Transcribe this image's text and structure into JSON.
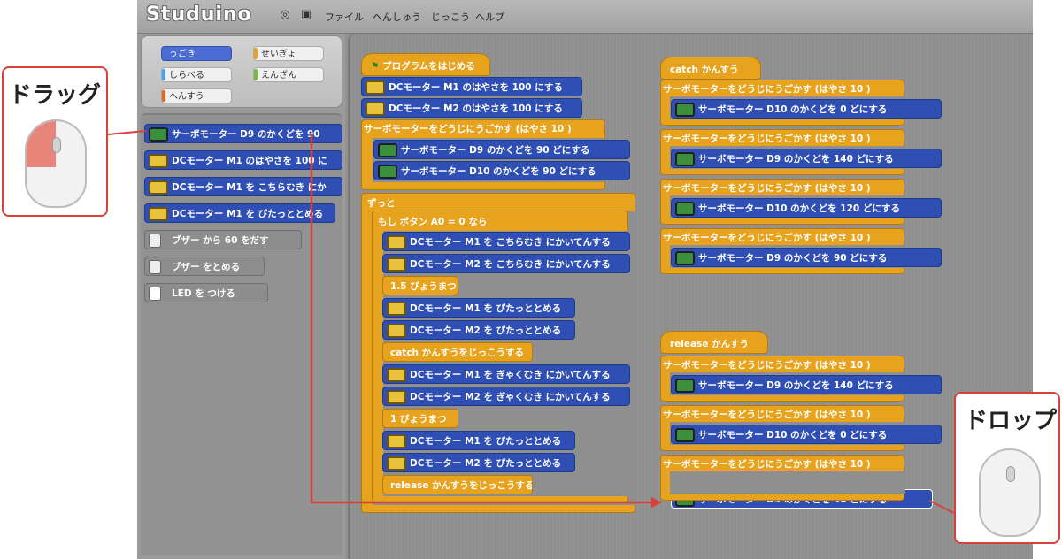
{
  "app": {
    "title": "Studuino"
  },
  "menu": [
    "ファイル",
    "へんしゅう",
    "じっこう",
    "ヘルプ"
  ],
  "categories": [
    {
      "label": "うごき",
      "color": "#4a6cd4",
      "selected": true
    },
    {
      "label": "せいぎょ",
      "color": "#e8a31e",
      "selected": false
    },
    {
      "label": "しらべる",
      "color": "#4aa3e8",
      "selected": false
    },
    {
      "label": "えんざん",
      "color": "#6fbf3a",
      "selected": false
    },
    {
      "label": "へんすう",
      "color": "#e8671e",
      "selected": false
    }
  ],
  "palette_blocks": [
    {
      "text": "サーボモーター D9 のかくどを 90",
      "icon": "servo-icon",
      "color": "blue"
    },
    {
      "text": "DCモーター M1 のはやさを 100 に",
      "icon": "motor-icon",
      "color": "blue"
    },
    {
      "text": "DCモーター M1 を こちらむき にか",
      "icon": "motor-icon",
      "color": "blue"
    },
    {
      "text": "DCモーター M1 を ぴたっととめる",
      "icon": "motor-icon",
      "color": "blue"
    },
    {
      "text": "ブザー から 60 をだす",
      "icon": "speaker-icon",
      "color": "gray"
    },
    {
      "text": "ブザー をとめる",
      "icon": "speaker-icon",
      "color": "gray"
    },
    {
      "text": "LED を つける",
      "icon": "led-icon",
      "color": "gray"
    }
  ],
  "main_script": {
    "hat": "プログラムをはじめる",
    "pre": [
      "DCモーター M1 のはやさを 100 にする",
      "DCモーター M2 のはやさを 100 にする"
    ],
    "sync_header": "サーボモーターをどうじにうごかす (はやさ 10 )",
    "sync_body": [
      "サーボモーター D9 のかくどを 90 どにする",
      "サーボモーター D10 のかくどを 90 どにする"
    ],
    "loop_label": "ずっと",
    "if_label": "もし ボタン A0 = 0 なら",
    "if_body": [
      {
        "text": "DCモーター M1 を こちらむき にかいてんする",
        "type": "motor"
      },
      {
        "text": "DCモーター M2 を こちらむき にかいてんする",
        "type": "motor"
      },
      {
        "text": "1.5 びょうまつ",
        "type": "wait"
      },
      {
        "text": "DCモーター M1 を ぴたっととめる",
        "type": "motor"
      },
      {
        "text": "DCモーター M2 を ぴたっととめる",
        "type": "motor"
      },
      {
        "text": "catch かんすうをじっこうする",
        "type": "call"
      },
      {
        "text": "DCモーター M1 を ぎゃくむき にかいてんする",
        "type": "motor"
      },
      {
        "text": "DCモーター M2 を ぎゃくむき にかいてんする",
        "type": "motor"
      },
      {
        "text": "1 びょうまつ",
        "type": "wait"
      },
      {
        "text": "DCモーター M1 を ぴたっととめる",
        "type": "motor"
      },
      {
        "text": "DCモーター M2 を ぴたっととめる",
        "type": "motor"
      },
      {
        "text": "release かんすうをじっこうする",
        "type": "call"
      }
    ]
  },
  "catch_script": {
    "hat": "catch かんすう",
    "groups": [
      {
        "header": "サーボモーターをどうじにうごかす (はやさ 10 )",
        "body": "サーボモーター D10 のかくどを 0 どにする"
      },
      {
        "header": "サーボモーターをどうじにうごかす (はやさ 10 )",
        "body": "サーボモーター D9 のかくどを 140 どにする"
      },
      {
        "header": "サーボモーターをどうじにうごかす (はやさ 10 )",
        "body": "サーボモーター D10 のかくどを 120 どにする"
      },
      {
        "header": "サーボモーターをどうじにうごかす (はやさ 10 )",
        "body": "サーボモーター D9 のかくどを 90 どにする"
      }
    ]
  },
  "release_script": {
    "hat": "release かんすう",
    "groups": [
      {
        "header": "サーボモーターをどうじにうごかす (はやさ 10 )",
        "body": "サーボモーター D9 のかくどを 140 どにする"
      },
      {
        "header": "サーボモーターをどうじにうごかす (はやさ 10 )",
        "body": "サーボモーター D10 のかくどを 0 どにする"
      },
      {
        "header": "サーボモーターをどうじにうごかす (はやさ 10 )",
        "body": ""
      }
    ],
    "dropped": "サーボモーター D9 のかくどを 90 どにする"
  },
  "callouts": {
    "drag": "ドラッグ",
    "drop": "ドロップ"
  },
  "colors": {
    "arrow": "#d8413a",
    "motion": "#2f4fb4",
    "control": "#e8a31e"
  }
}
